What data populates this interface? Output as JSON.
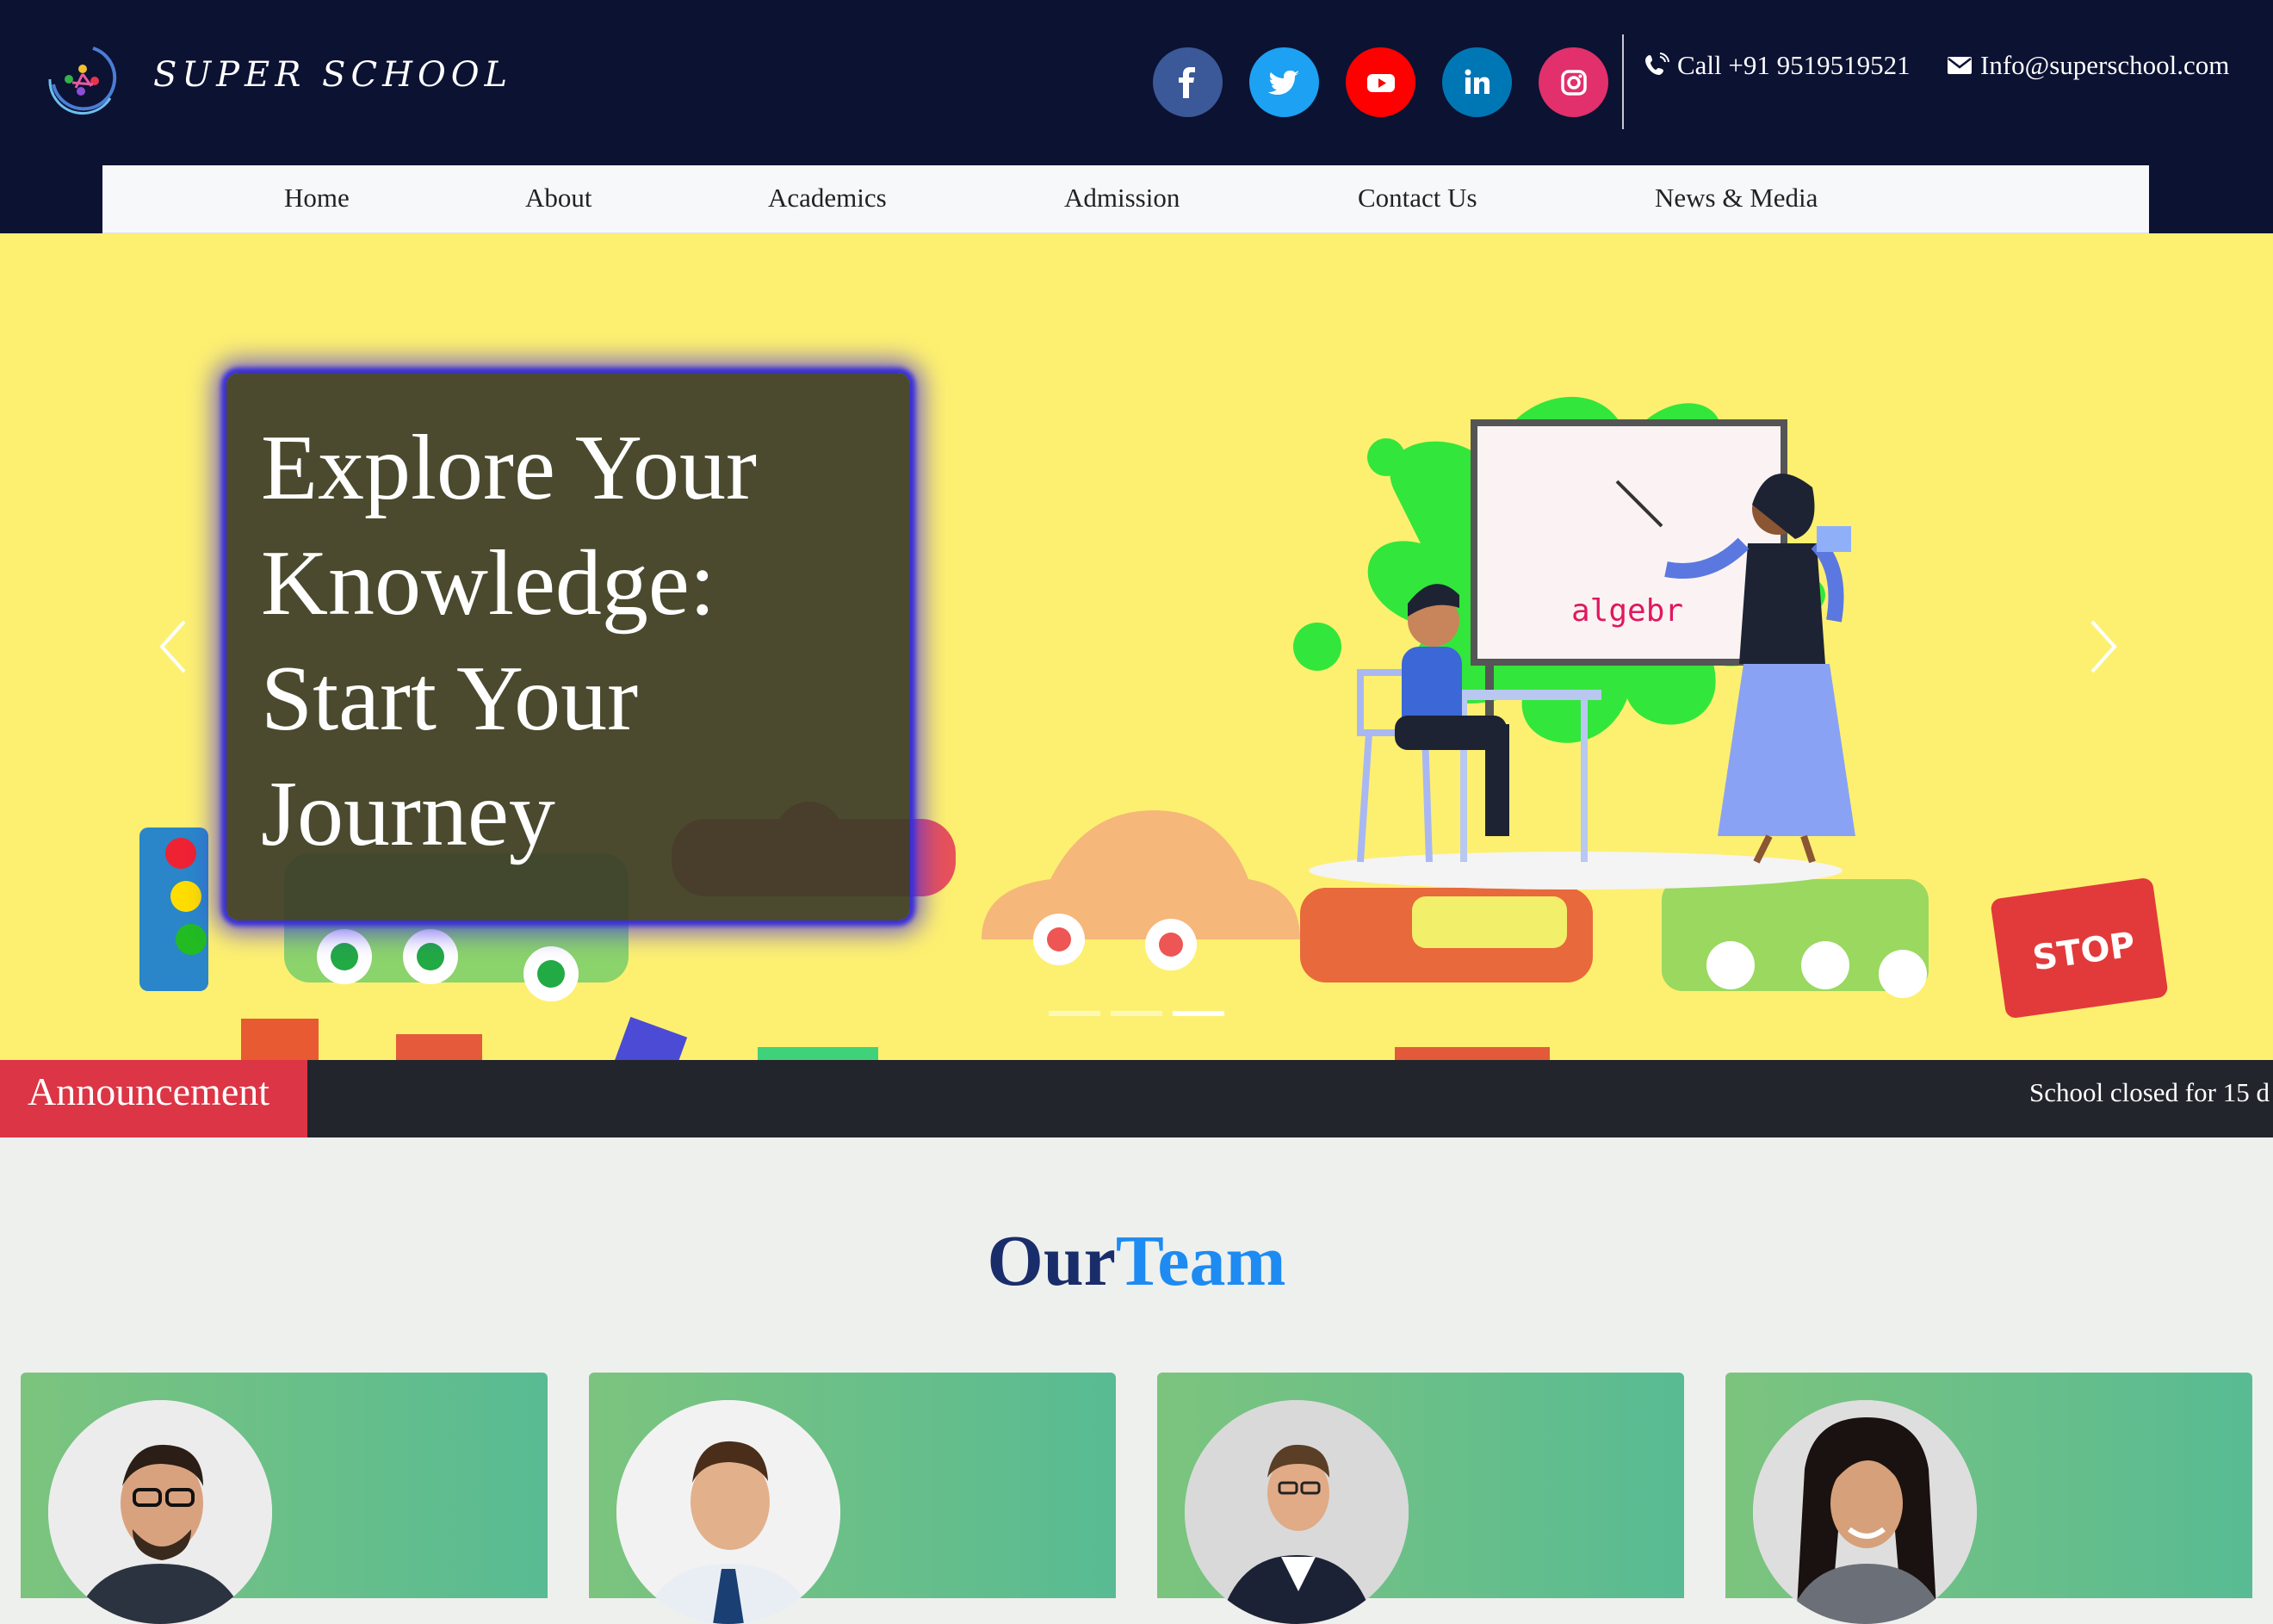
{
  "header": {
    "brand": "SUPER SCHOOL",
    "phone": "Call +91 9519519521",
    "email": "Info@superschool.com",
    "social": [
      {
        "name": "facebook",
        "icon": "facebook-icon",
        "color": "#3b5998"
      },
      {
        "name": "twitter",
        "icon": "twitter-icon",
        "color": "#1da1f2"
      },
      {
        "name": "youtube",
        "icon": "youtube-icon",
        "color": "#ff0000"
      },
      {
        "name": "linkedin",
        "icon": "linkedin-icon",
        "color": "#0077b5"
      },
      {
        "name": "instagram",
        "icon": "instagram-icon",
        "color": "#e1306c"
      }
    ]
  },
  "nav": {
    "items": [
      "Home",
      "About",
      "Academics",
      "Admission",
      "Contact Us",
      "News & Media"
    ]
  },
  "hero": {
    "line1": "Explore Your",
    "line2": "Knowledge:",
    "line3": "Start Your",
    "line4": "Journey",
    "board_text": "algebr",
    "stop_sign": "STOP",
    "slide_count": 3,
    "active_slide": 3
  },
  "announcement": {
    "label": "Announcement",
    "text": "School closed for 15 d"
  },
  "team": {
    "title_part1": "Our",
    "title_part2": "Team",
    "members": 4
  },
  "colors": {
    "topbar": "#0c1232",
    "hero_bg": "#fdf070",
    "announce_label": "#dc3545",
    "announce_bar": "#22252c",
    "team_title_dark": "#1a2d6b",
    "team_title_blue": "#1d8bf2"
  }
}
